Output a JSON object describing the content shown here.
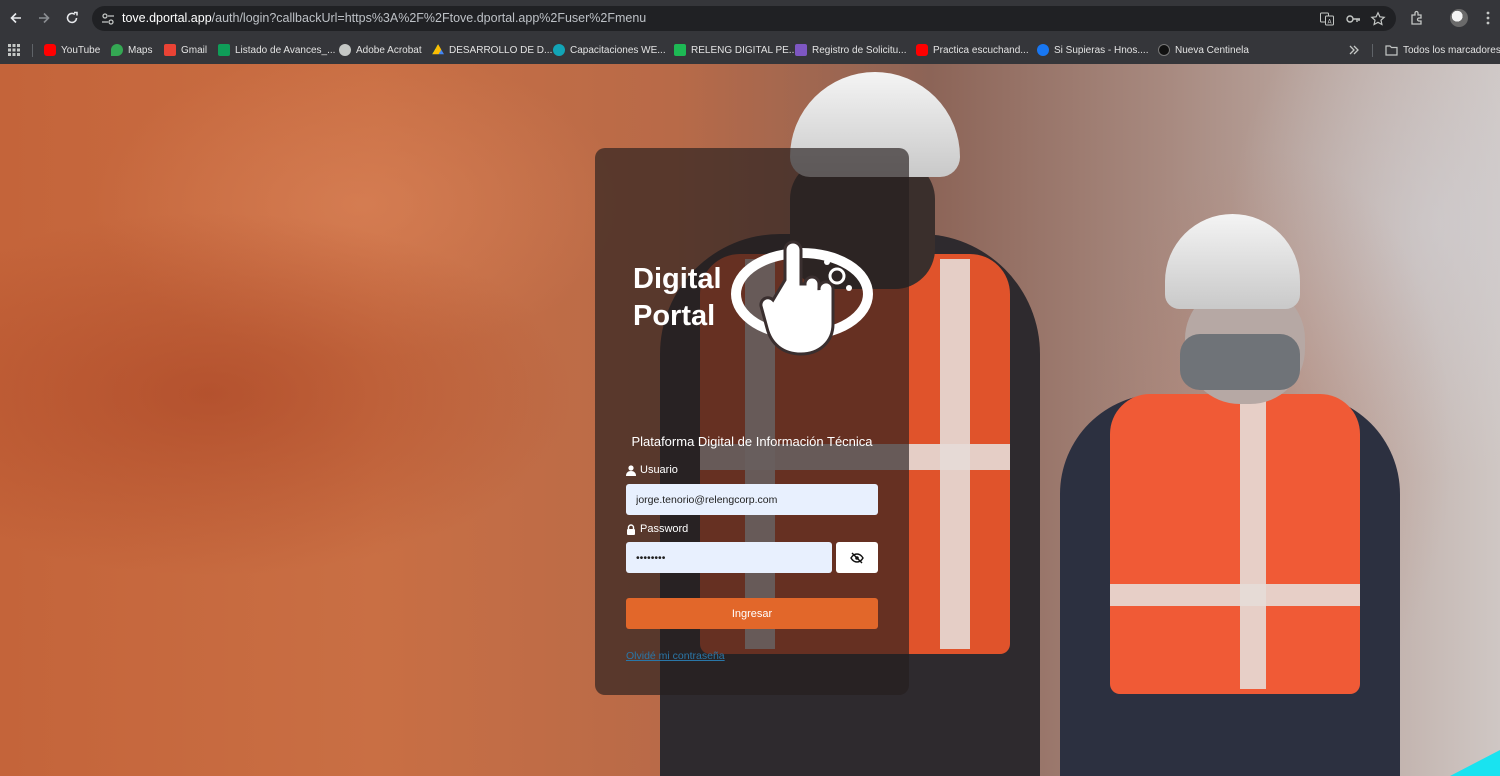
{
  "browser": {
    "url_host": "tove.dportal.app",
    "url_path": "/auth/login?callbackUrl=https%3A%2F%2Ftove.dportal.app%2Fuser%2Fmenu",
    "nav_icons": [
      "back-arrow-icon",
      "forward-arrow-icon",
      "reload-icon"
    ],
    "omnibox_icons": [
      "translate-icon",
      "key-icon",
      "star-icon"
    ],
    "toolbar_icons": [
      "extensions-icon",
      "profile-avatar",
      "more-menu-icon"
    ]
  },
  "bookmarks": {
    "items": [
      {
        "label": "YouTube",
        "icon": "youtube-icon",
        "color": "#ff0000"
      },
      {
        "label": "Maps",
        "icon": "maps-icon",
        "color": "#34a853"
      },
      {
        "label": "Gmail",
        "icon": "gmail-icon",
        "color": "#ea4335"
      },
      {
        "label": "Listado de Avances_...",
        "icon": "sheets-icon",
        "color": "#0f9d58"
      },
      {
        "label": "Adobe Acrobat",
        "icon": "globe-icon",
        "color": "#c4c7c5"
      },
      {
        "label": "DESARROLLO DE D...",
        "icon": "drive-icon",
        "color": "#fbbc04"
      },
      {
        "label": "Capacitaciones WE...",
        "icon": "site-icon",
        "color": "#12a4b6"
      },
      {
        "label": "RELENG DIGITAL PE...",
        "icon": "site-icon",
        "color": "#1db954"
      },
      {
        "label": "Registro de Solicitu...",
        "icon": "forms-icon",
        "color": "#7e57c2"
      },
      {
        "label": "Practica escuchand...",
        "icon": "youtube-icon",
        "color": "#ff0000"
      },
      {
        "label": "Si Supieras - Hnos....",
        "icon": "facebook-icon",
        "color": "#1877f2"
      },
      {
        "label": "Nueva Centinela",
        "icon": "site-icon",
        "color": "#111111"
      }
    ],
    "all_bookmarks_label": "Todos los marcadores"
  },
  "login": {
    "logo_line1": "Digital",
    "logo_line2": "Portal",
    "subtitle": "Plataforma Digital de Información Técnica",
    "user_label": "Usuario",
    "user_value": "jorge.tenorio@relengcorp.com",
    "password_label": "Password",
    "password_value": "••••••••",
    "submit_label": "Ingresar",
    "forgot_label": "Olvidé mi contraseña",
    "accent_color": "#e2672a"
  }
}
